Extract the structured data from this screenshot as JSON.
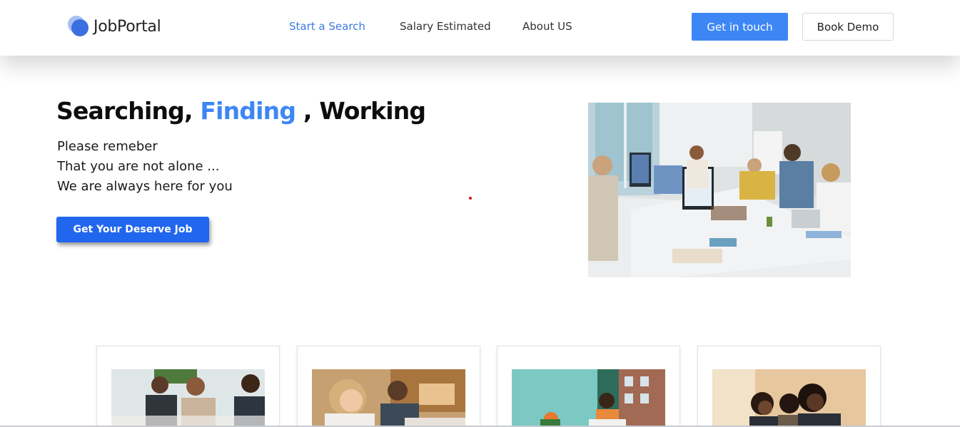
{
  "brand": {
    "name": "JobPortal"
  },
  "nav": {
    "items": [
      {
        "label": "Start a Search",
        "active": true
      },
      {
        "label": "Salary Estimated",
        "active": false
      },
      {
        "label": "About US",
        "active": false
      }
    ]
  },
  "header_buttons": {
    "get_in_touch": "Get in touch",
    "book_demo": "Book Demo"
  },
  "hero": {
    "title_part1": "Searching, ",
    "title_accent": "Finding",
    "title_part2": " , Working",
    "lines": [
      "Please remeber",
      "That you are not alone ...",
      "We are always here for you"
    ],
    "cta_label": "Get Your Deserve Job"
  },
  "colors": {
    "accent": "#3d86f5",
    "cta": "#2166ee",
    "nav_active": "#3a7be0"
  }
}
